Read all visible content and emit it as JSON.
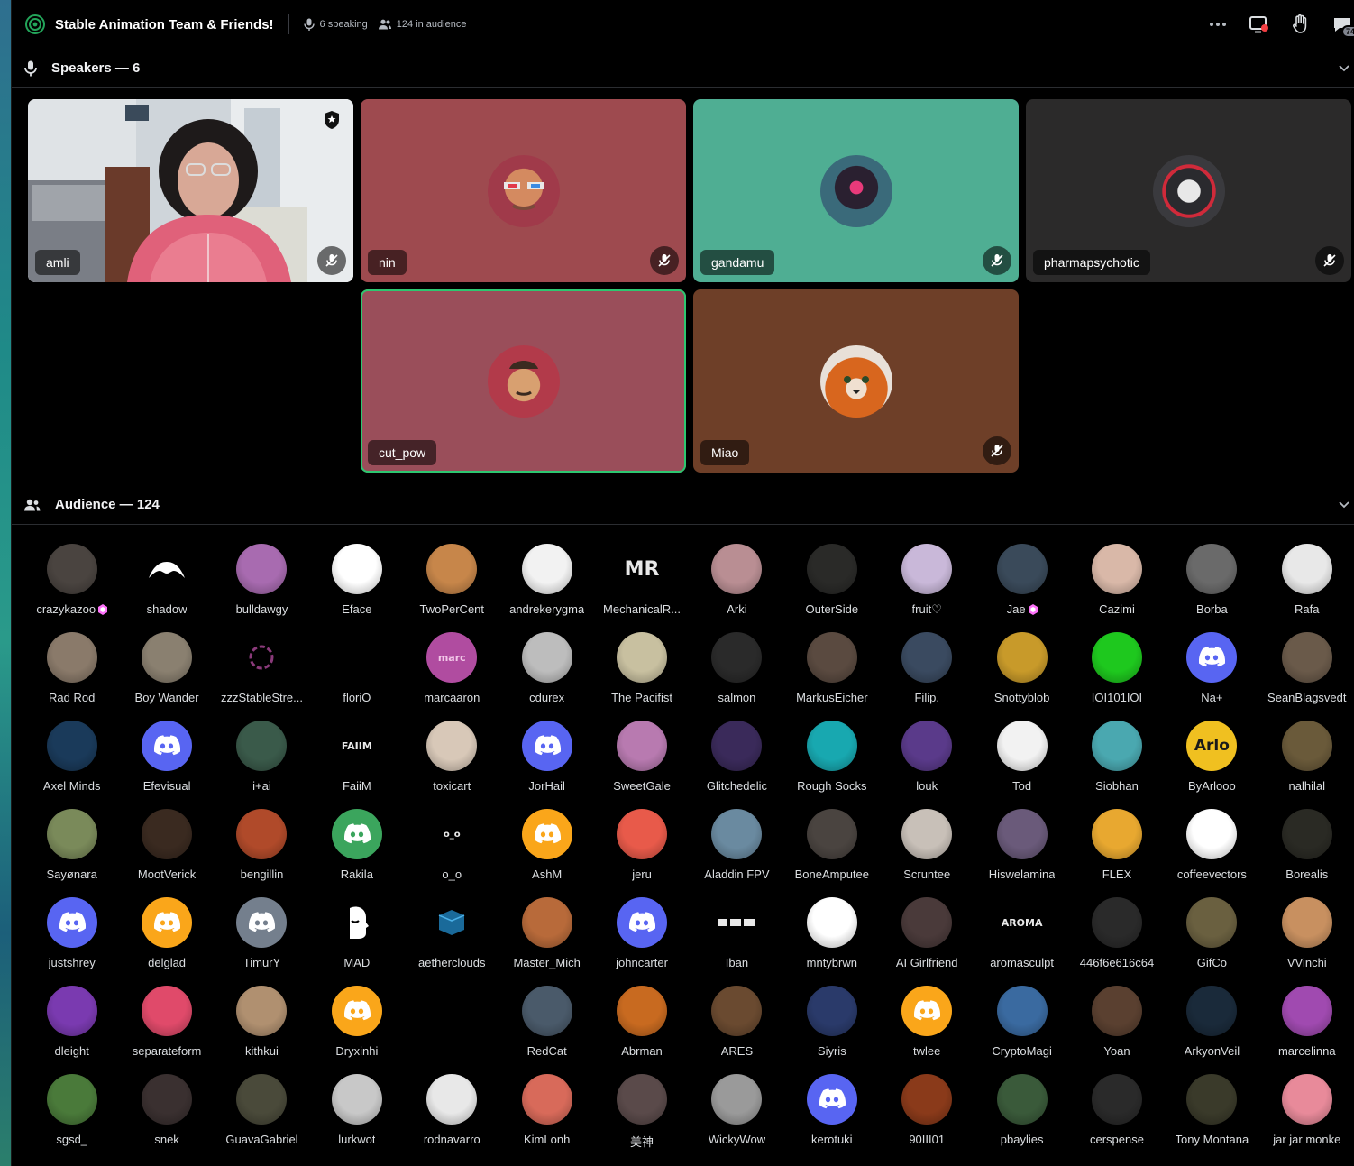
{
  "topbar": {
    "title": "Stable Animation Team & Friends!",
    "speaking": "6 speaking",
    "audience": "124 in audience",
    "notif_badge": "74"
  },
  "speakers_section": {
    "label": "Speakers — 6"
  },
  "audience_section": {
    "label": "Audience — 124"
  },
  "speakers": [
    {
      "name": "amli",
      "bg": "#3b3a38",
      "avatar": "#d9a8a0",
      "video": true,
      "moderator": true,
      "speaking": false
    },
    {
      "name": "nin",
      "bg": "#9e4a4f",
      "avatar": "#c97b5a",
      "video": false,
      "moderator": false,
      "speaking": false
    },
    {
      "name": "gandamu",
      "bg": "#4fae93",
      "avatar": "#20262c",
      "video": false,
      "moderator": false,
      "speaking": false
    },
    {
      "name": "pharmapsychotic",
      "bg": "#2b2a2a",
      "avatar": "#3d3d40",
      "video": false,
      "moderator": false,
      "speaking": false
    },
    {
      "name": "cut_pow",
      "bg": "#9a4e5a",
      "avatar": "#b26a66",
      "video": false,
      "moderator": false,
      "speaking": true
    },
    {
      "name": "Miao",
      "bg": "#6e3f28",
      "avatar": "#cf6b30",
      "video": false,
      "moderator": false,
      "speaking": false
    }
  ],
  "audience": [
    {
      "name": "crazykazoo",
      "color": "#4a4440",
      "boost": true
    },
    {
      "name": "shadow",
      "color": "#000000",
      "glyph": "wave"
    },
    {
      "name": "bulldawgy",
      "color": "#a86bb0"
    },
    {
      "name": "Eface",
      "color": "#ffffff"
    },
    {
      "name": "TwoPerCent",
      "color": "#c7864a"
    },
    {
      "name": "andrekerygma",
      "color": "#f2f2f2"
    },
    {
      "name": "MechanicalR...",
      "color": "#000000",
      "glyph": "MR"
    },
    {
      "name": "Arki",
      "color": "#b98e93"
    },
    {
      "name": "OuterSide",
      "color": "#2a2a28"
    },
    {
      "name": "fruit♡",
      "color": "#c9b8d9"
    },
    {
      "name": "Jae",
      "color": "#3a4a5a",
      "boost": true
    },
    {
      "name": "Cazimi",
      "color": "#d9b8a8"
    },
    {
      "name": "Borba",
      "color": "#6a6a6a"
    },
    {
      "name": "Rafa",
      "color": "#e8e8e8"
    },
    {
      "name": "Rad Rod",
      "color": "#8a7a6a"
    },
    {
      "name": "Boy Wander",
      "color": "#8a8070"
    },
    {
      "name": "zzzStableStre...",
      "color": "#000000",
      "glyph": "ring"
    },
    {
      "name": "floriO",
      "color": "#000000",
      "glyph": "none"
    },
    {
      "name": "marcaaron",
      "color": "#b04ca0",
      "glyph": "marc"
    },
    {
      "name": "cdurex",
      "color": "#bdbdbd"
    },
    {
      "name": "The Pacifist",
      "color": "#c8c0a0"
    },
    {
      "name": "salmon",
      "color": "#2a2a2a"
    },
    {
      "name": "MarkusEicher",
      "color": "#5a4a40"
    },
    {
      "name": "Filip.",
      "color": "#3a4a60"
    },
    {
      "name": "Snottyblob",
      "color": "#c89a2a"
    },
    {
      "name": "IOI101IOI",
      "color": "#1ec81e"
    },
    {
      "name": "Na+",
      "color": "#5865f2",
      "glyph": "discord"
    },
    {
      "name": "SeanBlagsvedt",
      "color": "#6a5a4a"
    },
    {
      "name": "Axel Minds",
      "color": "#1a3a5a"
    },
    {
      "name": "Efevisual",
      "color": "#5865f2",
      "glyph": "discord"
    },
    {
      "name": "i+ai",
      "color": "#3a5a4a"
    },
    {
      "name": "FaiiM",
      "color": "#000000",
      "glyph": "FAIIM"
    },
    {
      "name": "toxicart",
      "color": "#d8c8b8"
    },
    {
      "name": "JorHail",
      "color": "#5865f2",
      "glyph": "discord"
    },
    {
      "name": "SweetGale",
      "color": "#b87ab0"
    },
    {
      "name": "Glitchedelic",
      "color": "#3a2a5a"
    },
    {
      "name": "Rough Socks",
      "color": "#18a8b0"
    },
    {
      "name": "louk",
      "color": "#5a3a8a"
    },
    {
      "name": "Tod",
      "color": "#f2f2f2"
    },
    {
      "name": "Siobhan",
      "color": "#4aa8b0"
    },
    {
      "name": "ByArlooo",
      "color": "#f0c020",
      "glyph": "Arlo"
    },
    {
      "name": "nalhilal",
      "color": "#6a5a3a"
    },
    {
      "name": "Sayønara",
      "color": "#7a8a5a"
    },
    {
      "name": "MootVerick",
      "color": "#3a2a20"
    },
    {
      "name": "bengillin",
      "color": "#b04a2a"
    },
    {
      "name": "Rakila",
      "color": "#3ba55d",
      "glyph": "discord"
    },
    {
      "name": "o_o",
      "color": "#000000",
      "glyph": "o_o"
    },
    {
      "name": "AshM",
      "color": "#faa61a",
      "glyph": "discord"
    },
    {
      "name": "jeru",
      "color": "#e85a4a"
    },
    {
      "name": "Aladdin FPV",
      "color": "#6a8aa0"
    },
    {
      "name": "BoneAmputee",
      "color": "#4a4440"
    },
    {
      "name": "Scruntee",
      "color": "#c8c0b8"
    },
    {
      "name": "Hiswelamina",
      "color": "#6a5a7a"
    },
    {
      "name": "FLEX",
      "color": "#e8a830"
    },
    {
      "name": "coffeevectors",
      "color": "#ffffff"
    },
    {
      "name": "Borealis",
      "color": "#2a2a24"
    },
    {
      "name": "justshrey",
      "color": "#5865f2",
      "glyph": "discord"
    },
    {
      "name": "delglad",
      "color": "#faa61a",
      "glyph": "discord"
    },
    {
      "name": "TimurY",
      "color": "#747f8d",
      "glyph": "discord"
    },
    {
      "name": "MAD",
      "color": "#000000",
      "glyph": "head"
    },
    {
      "name": "aetherclouds",
      "color": "#000000",
      "glyph": "cube"
    },
    {
      "name": "Master_Mich",
      "color": "#b86a3a"
    },
    {
      "name": "johncarter",
      "color": "#5865f2",
      "glyph": "discord"
    },
    {
      "name": "Iban",
      "color": "#000000",
      "glyph": "blocks"
    },
    {
      "name": "mntybrwn",
      "color": "#ffffff"
    },
    {
      "name": "AI Girlfriend",
      "color": "#4a3a3a"
    },
    {
      "name": "aromasculpt",
      "color": "#000000",
      "glyph": "aroma"
    },
    {
      "name": "446f6e616c64",
      "color": "#2a2a2a"
    },
    {
      "name": "GifCo",
      "color": "#6a6040"
    },
    {
      "name": "VVinchi",
      "color": "#c89060"
    },
    {
      "name": "dleight",
      "color": "#7a3ab0"
    },
    {
      "name": "separateform",
      "color": "#e04a6a"
    },
    {
      "name": "kithkui",
      "color": "#b09070"
    },
    {
      "name": "Dryxinhi",
      "color": "#faa61a",
      "glyph": "discord"
    },
    {
      "name": "",
      "color": "#000000",
      "glyph": "none"
    },
    {
      "name": "RedCat",
      "color": "#4a5a6a"
    },
    {
      "name": "Abrman",
      "color": "#c86a20"
    },
    {
      "name": "ARES",
      "color": "#6a4a30"
    },
    {
      "name": "Siyris",
      "color": "#2a3a6a"
    },
    {
      "name": "twlee",
      "color": "#faa61a",
      "glyph": "discord"
    },
    {
      "name": "CryptoMagi",
      "color": "#3a6aa0"
    },
    {
      "name": "Yoan",
      "color": "#5a4030"
    },
    {
      "name": "ArkyonVeil",
      "color": "#1a2a3a"
    },
    {
      "name": "marcelinna",
      "color": "#a04ab0"
    },
    {
      "name": "sgsd_",
      "color": "#4a7a3a"
    },
    {
      "name": "snek",
      "color": "#3a3030"
    },
    {
      "name": "GuavaGabriel",
      "color": "#4a4a3a"
    },
    {
      "name": "lurkwot",
      "color": "#c8c8c8"
    },
    {
      "name": "rodnavarro",
      "color": "#e8e8e8"
    },
    {
      "name": "KimLonh",
      "color": "#d86a5a"
    },
    {
      "name": "美神",
      "color": "#5a4a4a"
    },
    {
      "name": "WickyWow",
      "color": "#9a9a9a"
    },
    {
      "name": "kerotuki",
      "color": "#5865f2",
      "glyph": "discord"
    },
    {
      "name": "90III01",
      "color": "#8a3a1a"
    },
    {
      "name": "pbaylies",
      "color": "#3a5a3a"
    },
    {
      "name": "cerspense",
      "color": "#2a2a2a"
    },
    {
      "name": "Tony Montana",
      "color": "#3a3a2a"
    },
    {
      "name": "jar jar monke",
      "color": "#e88a9a"
    }
  ]
}
